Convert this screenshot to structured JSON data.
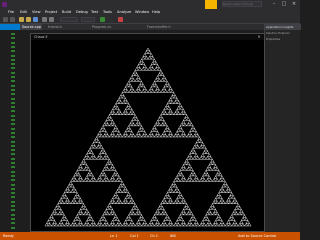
{
  "window": {
    "title": "",
    "accent_color": "#f4b400",
    "status_color": "#ca5100"
  },
  "menu": [
    "File",
    "Edit",
    "View",
    "Project",
    "Build",
    "Debug",
    "Test",
    "Tools",
    "Analyze",
    "Window",
    "Help"
  ],
  "search": {
    "placeholder": "Quick Launch (Ctrl+Q)"
  },
  "tabs": [
    {
      "label": "Source.cpp",
      "active": true
    },
    {
      "label": "fractal.h",
      "active": false
    },
    {
      "label": "Program.cs",
      "active": false
    },
    {
      "label": "Framebuffer.h",
      "active": false
    }
  ],
  "right_panel": {
    "tab1": "Application Insights",
    "tab2": "Solution Explorer",
    "tab3": "Properties"
  },
  "console": {
    "title": "Chaos E",
    "background": "#000000",
    "fractal_color": "#ffffff"
  },
  "statusbar": {
    "left": "Ready",
    "items": [
      "Ln 1",
      "Col 1",
      "Ch 1",
      "INS"
    ],
    "right": "Add to Source Control"
  }
}
